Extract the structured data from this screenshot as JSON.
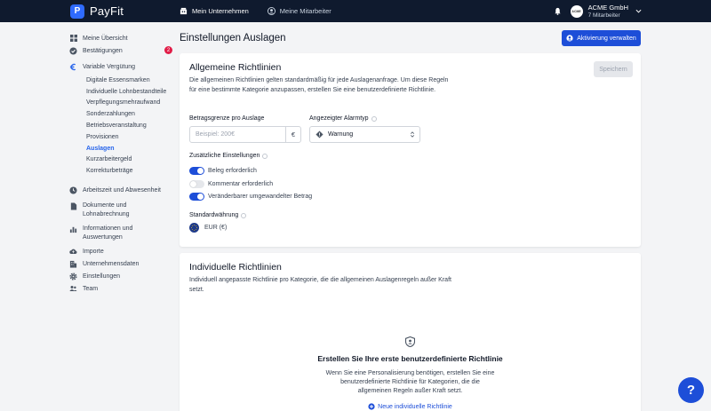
{
  "app": {
    "name": "PayFit",
    "logo_letter": "P"
  },
  "topnav": {
    "items": [
      {
        "label": "Mein Unternehmen",
        "icon": "building-icon",
        "active": true
      },
      {
        "label": "Meine Mitarbeiter",
        "icon": "user-circle-icon",
        "active": false
      }
    ]
  },
  "company": {
    "avatar_text": "ACME",
    "name": "ACME GmbH",
    "subtitle": "7 Mitarbeiter"
  },
  "sidebar": {
    "items": [
      {
        "label": "Meine Übersicht",
        "icon": "grid-icon"
      },
      {
        "label": "Bestätigungen",
        "icon": "check-circle-icon",
        "badge": "2"
      },
      {
        "label": "Variable Vergütung",
        "icon": "euro-icon"
      },
      {
        "label": "Arbeitszeit und Abwesenheit",
        "icon": "clock-icon"
      },
      {
        "label": "Dokumente und Lohnabrechnung",
        "icon": "document-icon"
      },
      {
        "label": "Informationen und Auswertungen",
        "icon": "bar-chart-icon"
      },
      {
        "label": "Importe",
        "icon": "cloud-upload-icon"
      },
      {
        "label": "Unternehmensdaten",
        "icon": "building-icon"
      },
      {
        "label": "Einstellungen",
        "icon": "gear-icon"
      },
      {
        "label": "Team",
        "icon": "users-icon"
      }
    ],
    "sub_items": [
      {
        "label": "Digitale Essensmarken"
      },
      {
        "label": "Individuelle Lohnbestandteile"
      },
      {
        "label": "Verpflegungsmehraufwand"
      },
      {
        "label": "Sonderzahlungen"
      },
      {
        "label": "Betriebsveranstaltung"
      },
      {
        "label": "Provisionen"
      },
      {
        "label": "Auslagen",
        "active": true
      },
      {
        "label": "Kurzarbeitergeld"
      },
      {
        "label": "Korrekturbeträge"
      }
    ]
  },
  "page": {
    "title": "Einstellungen Auslagen",
    "primary_action": "Aktivierung verwalten"
  },
  "general": {
    "title": "Allgemeine Richtlinien",
    "description": "Die allgemeinen Richtlinien gelten standardmäßig für jede Auslagenanfrage. Um diese Regeln für eine bestimmte Kategorie anzupassen, erstellen Sie eine benutzerdefinierte Richtlinie.",
    "save_label": "Speichern",
    "limit_label": "Betragsgrenze pro Auslage",
    "limit_placeholder": "Beispiel: 200€",
    "limit_unit": "€",
    "alarm_label": "Angezeigter Alarmtyp",
    "alarm_value": "Warnung",
    "extra_label": "Zusätzliche Einstellungen",
    "toggles": [
      {
        "label": "Beleg erforderlich",
        "on": true
      },
      {
        "label": "Kommentar erforderlich",
        "on": false
      },
      {
        "label": "Veränderbarer umgewandelter Betrag",
        "on": true
      }
    ],
    "currency_label": "Standardwährung",
    "currency_value": "EUR (€)"
  },
  "custom": {
    "title": "Individuelle Richtlinien",
    "description": "Individuell angepasste Richtlinie pro Kategorie, die die allgemeinen Auslagenregeln außer Kraft setzt.",
    "empty_title": "Erstellen Sie Ihre erste benutzerdefinierte Richtlinie",
    "empty_desc": "Wenn Sie eine Personalisierung benötigen, erstellen Sie eine benutzerdefinierte Richtlinie für Kategorien, die die allgemeinen Regeln außer Kraft setzt.",
    "new_label": "Neue individuelle Richtlinie"
  },
  "help": {
    "label": "?"
  },
  "colors": {
    "topbar": "#0f1a2e",
    "primary": "#1d4ed8",
    "badge": "#e11d48"
  }
}
